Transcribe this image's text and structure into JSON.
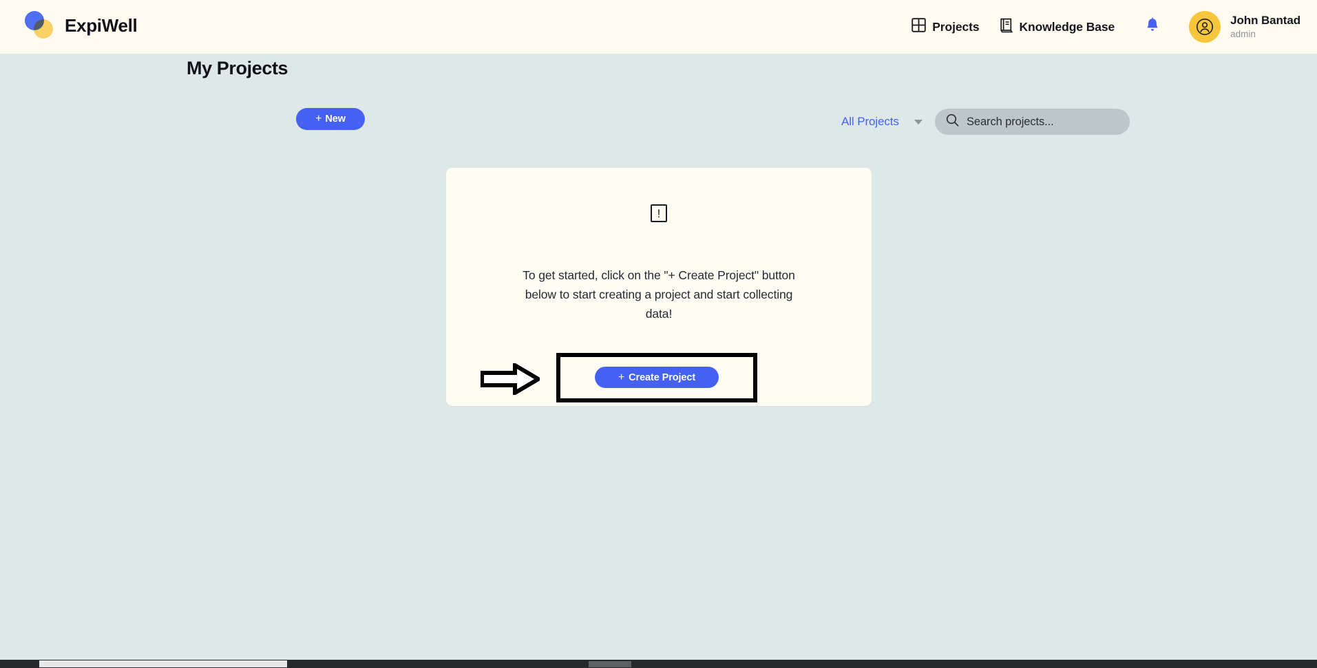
{
  "header": {
    "brand_name": "ExpiWell",
    "logo_icon": "overlapping-circles-logo",
    "nav": [
      {
        "label": "Projects",
        "icon": "grid-icon"
      },
      {
        "label": "Knowledge Base",
        "icon": "book-icon"
      }
    ],
    "notifications_icon": "bell-icon",
    "avatar_icon": "user-circle-icon",
    "user_name": "John Bantad",
    "user_role": "admin"
  },
  "toolbar": {
    "page_title": "My Projects",
    "new_button_label": "New",
    "new_button_plus": "+",
    "filter_label": "All Projects",
    "filter_caret_icon": "chevron-down-icon",
    "search_icon": "search-icon",
    "search_placeholder": "Search projects...",
    "search_value": ""
  },
  "empty_state": {
    "warning_icon": "exclamation-box-icon",
    "warning_glyph": "!",
    "message": "To get started, click on the \"+ Create Project\" button below to start creating a project and start collecting data!",
    "create_button_label": "Create Project",
    "create_button_plus": "+",
    "annotation_arrow_icon": "right-arrow-annotation",
    "annotation_box": "highlight-rectangle"
  },
  "colors": {
    "page_background": "#dfe8e9",
    "header_background": "#fffbf1",
    "card_background": "#fffcf4",
    "accent_blue": "#4461f2",
    "avatar_yellow": "#f8c63d",
    "search_gray": "#bcc6cb",
    "text_dark": "#16181f",
    "text_muted": "#8d9499",
    "annotation_black": "#000000"
  }
}
